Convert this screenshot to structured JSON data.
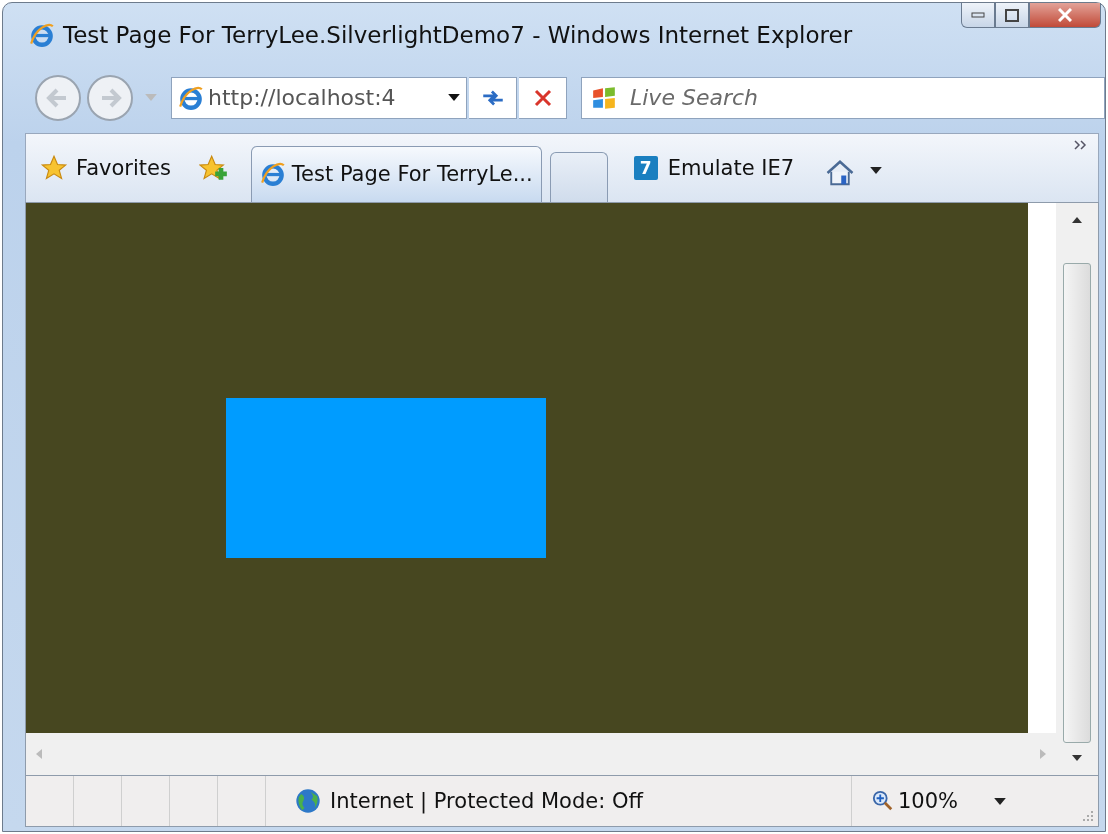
{
  "window": {
    "title": "Test Page For TerryLee.SilverlightDemo7 - Windows Internet Explorer"
  },
  "address_bar": {
    "value": "http://localhost:4"
  },
  "search": {
    "placeholder": "Live Search"
  },
  "favorites_bar": {
    "favorites": "Favorites",
    "tabs": [
      {
        "kind": "page",
        "label": "Test Page For TerryLe...",
        "selected": true
      },
      {
        "kind": "new",
        "selected": false
      }
    ],
    "emulate": {
      "icon": "7",
      "label": "Emulate IE7"
    }
  },
  "content": {
    "shapes": [
      {
        "kind": "rectangle"
      }
    ]
  },
  "status_bar": {
    "zone": "Internet | Protected Mode: Off",
    "zoom": "100%"
  }
}
